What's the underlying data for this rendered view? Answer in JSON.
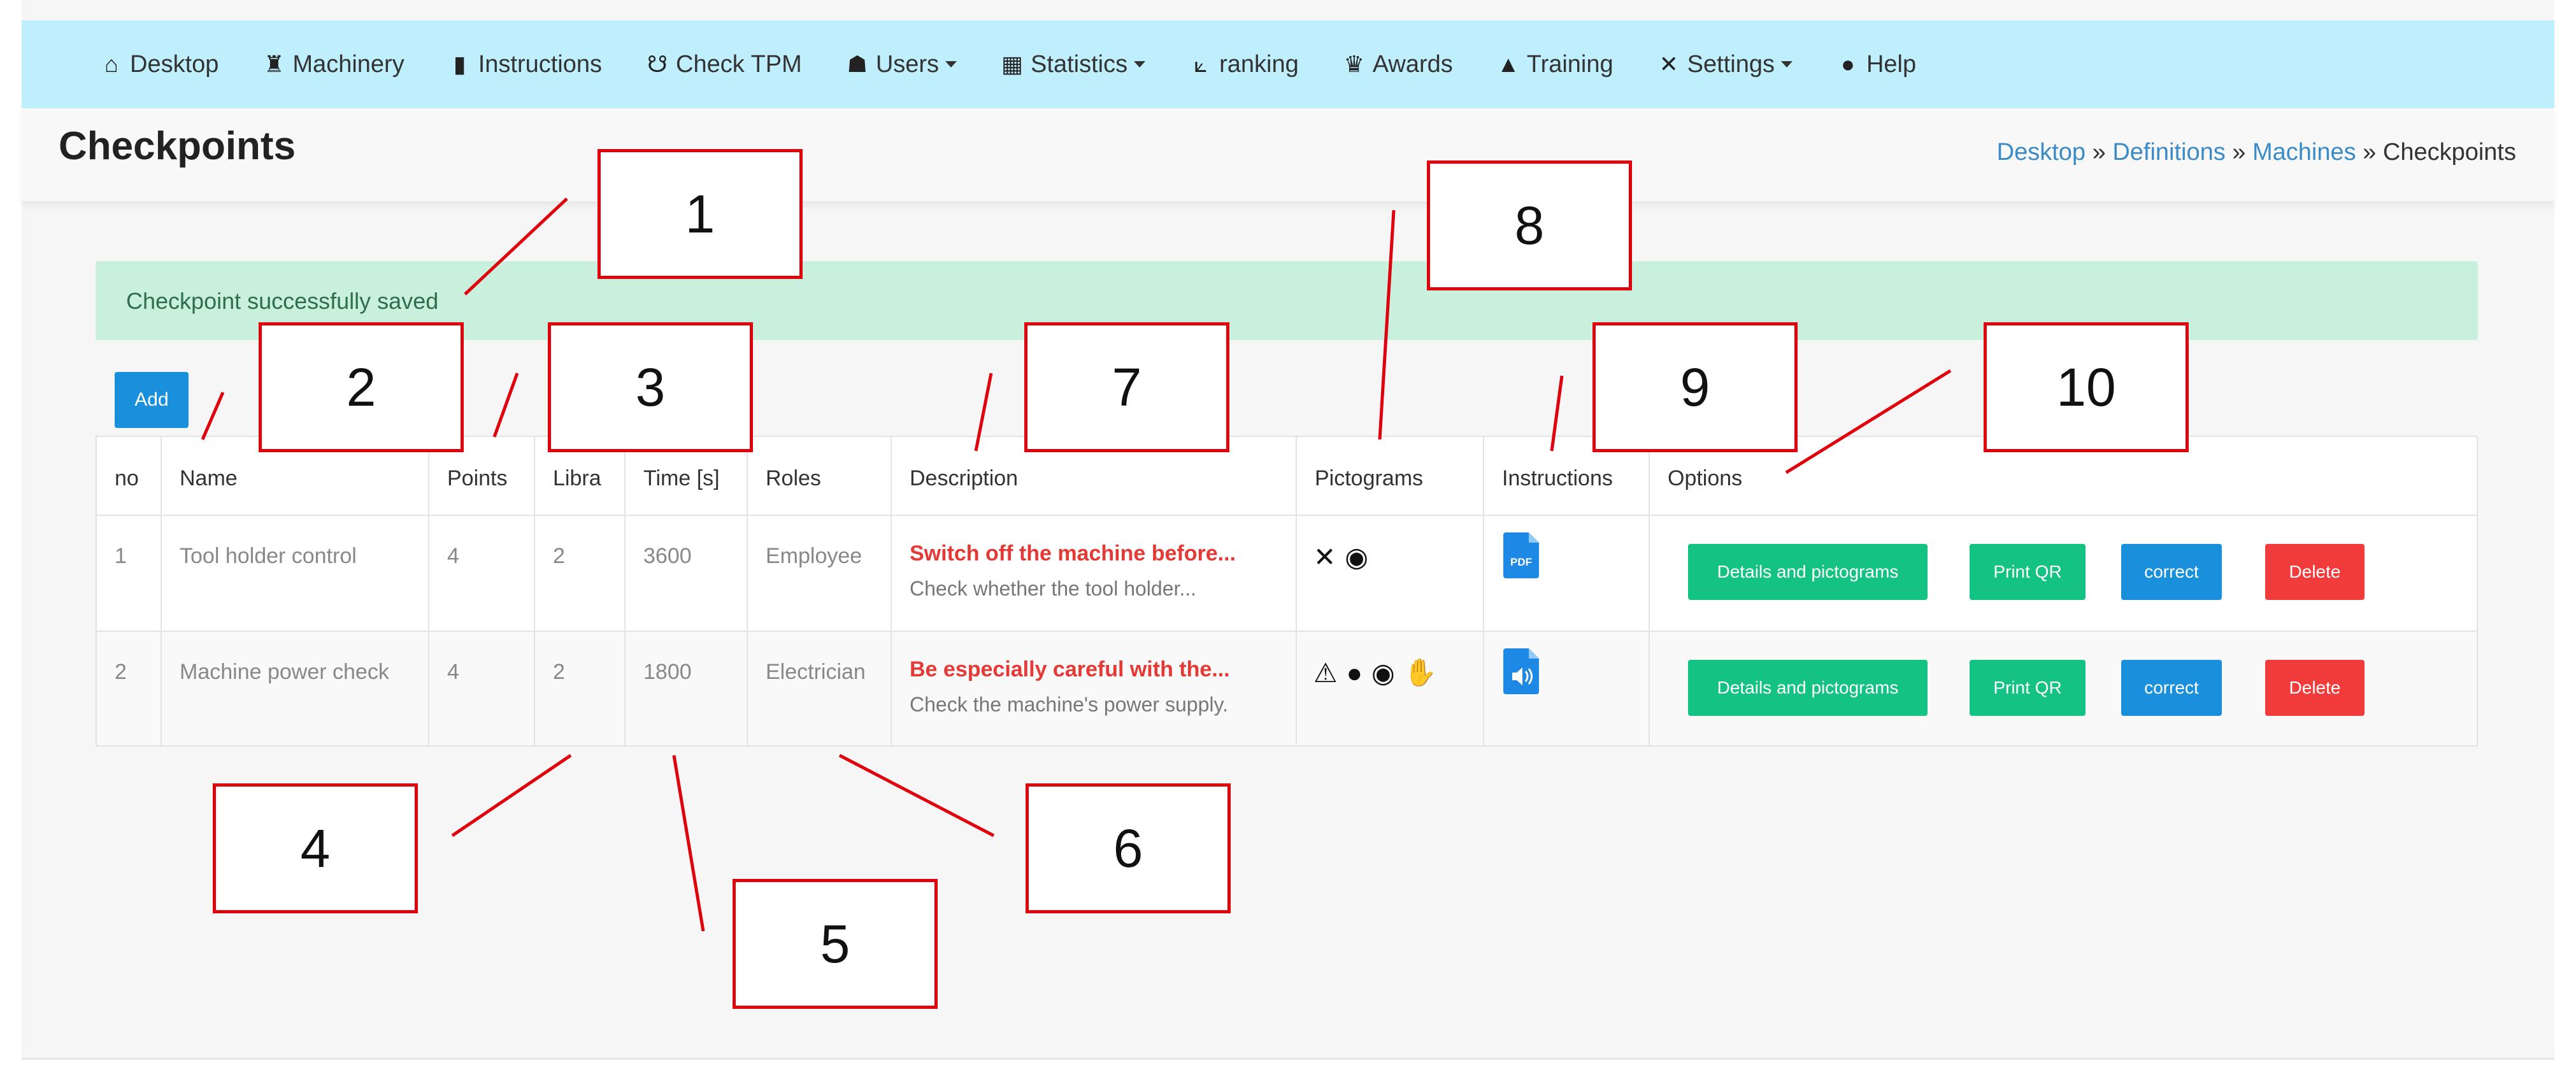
{
  "navbar": {
    "items": [
      {
        "label": "Desktop",
        "icon": "home-icon",
        "glyph": "⌂",
        "dropdown": false
      },
      {
        "label": "Machinery",
        "icon": "machinery-icon",
        "glyph": "♜",
        "dropdown": false
      },
      {
        "label": "Instructions",
        "icon": "file-icon",
        "glyph": "▮",
        "dropdown": false
      },
      {
        "label": "Check TPM",
        "icon": "check-icon",
        "glyph": "☋",
        "dropdown": false
      },
      {
        "label": "Users",
        "icon": "users-icon",
        "glyph": "☗",
        "dropdown": true
      },
      {
        "label": "Statistics",
        "icon": "statistics-icon",
        "glyph": "▦",
        "dropdown": true
      },
      {
        "label": "ranking",
        "icon": "line-chart-icon",
        "glyph": "⟀",
        "dropdown": false
      },
      {
        "label": "Awards",
        "icon": "trophy-icon",
        "glyph": "♛",
        "dropdown": false
      },
      {
        "label": "Training",
        "icon": "graduation-cap-icon",
        "glyph": "🎓",
        "dropdown": false
      },
      {
        "label": "Settings",
        "icon": "tools-icon",
        "glyph": "✕",
        "dropdown": true
      },
      {
        "label": "Help",
        "icon": "question-icon",
        "glyph": "❓",
        "dropdown": false
      }
    ]
  },
  "header": {
    "title": "Checkpoints",
    "breadcrumb": {
      "items": [
        "Desktop",
        "Definitions",
        "Machines"
      ],
      "current": "Checkpoints",
      "separator": " » "
    }
  },
  "alert": {
    "text": "Checkpoint successfully saved"
  },
  "add_button": {
    "label": "Add"
  },
  "table": {
    "columns": [
      "no",
      "Name",
      "Points",
      "Libra",
      "Time [s]",
      "Roles",
      "Description",
      "Pictograms",
      "Instructions",
      "Options"
    ],
    "rows": [
      {
        "no": "1",
        "name": "Tool holder control",
        "points": "4",
        "libra": "2",
        "time": "3600",
        "roles": "Employee",
        "description_title": "Switch off the machine before...",
        "description_text": "Check whether the tool holder...",
        "pictograms": [
          "tools-icon",
          "eye-icon"
        ],
        "instruction": "pdf-file-icon"
      },
      {
        "no": "2",
        "name": "Machine power check",
        "points": "4",
        "libra": "2",
        "time": "1800",
        "roles": "Electrician",
        "description_title": "Be especially careful with the...",
        "description_text": "Check the machine's power supply.",
        "pictograms": [
          "warning-icon",
          "helmet-icon",
          "eye-icon",
          "hand-icon"
        ],
        "instruction": "audio-file-icon"
      }
    ],
    "options": {
      "details": "Details and pictograms",
      "print": "Print QR",
      "correct": "correct",
      "delete": "Delete"
    }
  },
  "annotations": [
    "1",
    "2",
    "3",
    "4",
    "5",
    "6",
    "7",
    "8",
    "9",
    "10"
  ],
  "colors": {
    "navbar_bg": "#bfeefc",
    "alert_bg": "#c9f0dc",
    "primary": "#1a8fdc",
    "success": "#14c384",
    "danger": "#f23b3b",
    "description_red": "#e53935",
    "annotation_red": "#e0000b"
  }
}
